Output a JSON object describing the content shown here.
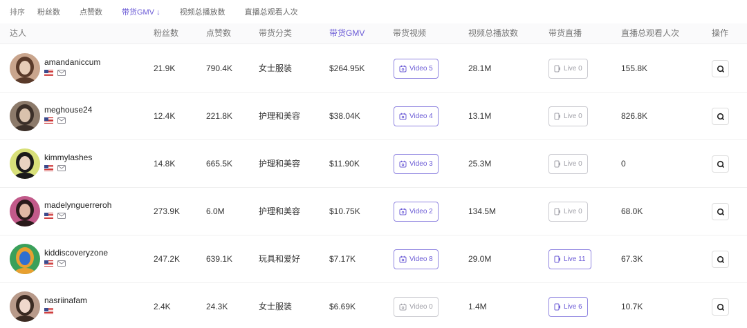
{
  "sort": {
    "label": "排序",
    "options": [
      {
        "label": "粉丝数",
        "active": false
      },
      {
        "label": "点赞数",
        "active": false
      },
      {
        "label": "带货GMV ↓",
        "active": true
      },
      {
        "label": "视频总播放数",
        "active": false
      },
      {
        "label": "直播总观看人次",
        "active": false
      }
    ]
  },
  "columns": {
    "creator": "达人",
    "followers": "粉丝数",
    "likes": "点赞数",
    "category": "带货分类",
    "gmv": "带货GMV",
    "videos": "带货视频",
    "video_views": "视频总播放数",
    "lives": "带货直播",
    "live_viewers": "直播总观看人次",
    "actions": "操作"
  },
  "colors": {
    "accent": "#6b5bd6",
    "pill_active_border": "#8f84e0",
    "pill_dim": "#c9c9cf"
  },
  "rows": [
    {
      "name": "amandaniccum",
      "followers": "21.9K",
      "likes": "790.4K",
      "category": "女士服装",
      "gmv": "$264.95K",
      "video": "Video 5",
      "video_active": true,
      "views": "28.1M",
      "live": "Live 0",
      "live_active": false,
      "live_viewers": "155.8K",
      "avatar_colors": [
        "#c9a58d",
        "#5a3a2a",
        "#e8cdb8"
      ],
      "has_mail": true
    },
    {
      "name": "meghouse24",
      "followers": "12.4K",
      "likes": "221.8K",
      "category": "护理和美容",
      "gmv": "$38.04K",
      "video": "Video 4",
      "video_active": true,
      "views": "13.1M",
      "live": "Live 0",
      "live_active": false,
      "live_viewers": "826.8K",
      "avatar_colors": [
        "#8c7a6a",
        "#3b2f28",
        "#d9c2ad"
      ],
      "has_mail": true
    },
    {
      "name": "kimmylashes",
      "followers": "14.8K",
      "likes": "665.5K",
      "category": "护理和美容",
      "gmv": "$11.90K",
      "video": "Video 3",
      "video_active": true,
      "views": "25.3M",
      "live": "Live 0",
      "live_active": false,
      "live_viewers": "0",
      "avatar_colors": [
        "#d8e07a",
        "#1a1a1a",
        "#e9d2c0"
      ],
      "has_mail": true
    },
    {
      "name": "madelynguerreroh",
      "followers": "273.9K",
      "likes": "6.0M",
      "category": "护理和美容",
      "gmv": "$10.75K",
      "video": "Video 2",
      "video_active": true,
      "views": "134.5M",
      "live": "Live 0",
      "live_active": false,
      "live_viewers": "68.0K",
      "avatar_colors": [
        "#c25a8a",
        "#2a1a1a",
        "#e0b8a4"
      ],
      "has_mail": true
    },
    {
      "name": "kiddiscoveryzone",
      "followers": "247.2K",
      "likes": "639.1K",
      "category": "玩具和爱好",
      "gmv": "$7.17K",
      "video": "Video 8",
      "video_active": true,
      "views": "29.0M",
      "live": "Live 11",
      "live_active": true,
      "live_viewers": "67.3K",
      "avatar_colors": [
        "#3aa05a",
        "#e8a030",
        "#2f6fd0"
      ],
      "has_mail": true
    },
    {
      "name": "nasriinafam",
      "followers": "2.4K",
      "likes": "24.3K",
      "category": "女士服装",
      "gmv": "$6.69K",
      "video": "Video 0",
      "video_active": false,
      "views": "1.4M",
      "live": "Live 6",
      "live_active": true,
      "live_viewers": "10.7K",
      "avatar_colors": [
        "#b89a8a",
        "#3a2a22",
        "#f0d8cc"
      ],
      "has_mail": false
    }
  ]
}
